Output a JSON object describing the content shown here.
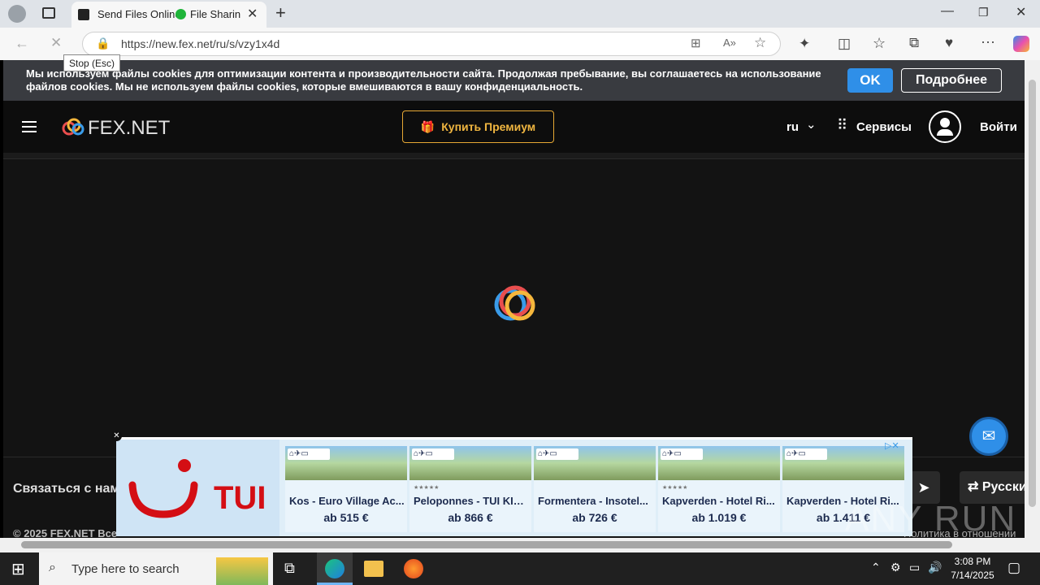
{
  "browser": {
    "tab_title": "Send Files Online",
    "tab_extra": "File Sharing",
    "url": "https://new.fex.net/ru/s/vzy1x4d",
    "tooltip": "Stop (Esc)"
  },
  "cookie": {
    "text": "Мы используем файлы cookies для оптимизации контента и производительности сайта. Продолжая пребывание, вы соглашаетесь на использование файлов cookies. Мы не используем файлы cookies, которые вмешиваются в вашу конфиденциальность.",
    "ok": "OK",
    "more": "Подробнее"
  },
  "header": {
    "logo": "FEX.NET",
    "premium": "Купить Премиум",
    "lang": "ru",
    "services": "Сервисы",
    "login": "Войти"
  },
  "footer": {
    "contact": "Связаться с нами",
    "language": "Русский",
    "copyright": "© 2025 FEX.NET Все",
    "policy": "Политика в отношении"
  },
  "ad": {
    "brand": "TUI",
    "cards": [
      {
        "name": "Kos - Euro Village Ac...",
        "price": "ab 515 €",
        "stars": ""
      },
      {
        "name": "Peloponnes - TUI KID...",
        "price": "ab 866 €",
        "stars": "★★★★★"
      },
      {
        "name": "Formentera - Insotel...",
        "price": "ab 726 €",
        "stars": ""
      },
      {
        "name": "Kapverden - Hotel Ri...",
        "price": "ab 1.019 €",
        "stars": "★★★★★"
      },
      {
        "name": "Kapverden - Hotel Ri...",
        "price": "ab 1.411 €",
        "stars": ""
      }
    ]
  },
  "taskbar": {
    "search_placeholder": "Type here to search",
    "time": "3:08 PM",
    "date": "7/14/2025"
  },
  "watermark": "ANY RUN",
  "colors": {
    "accent": "#2f8fe8",
    "premium": "#f0b640",
    "tui": "#d40e14"
  }
}
